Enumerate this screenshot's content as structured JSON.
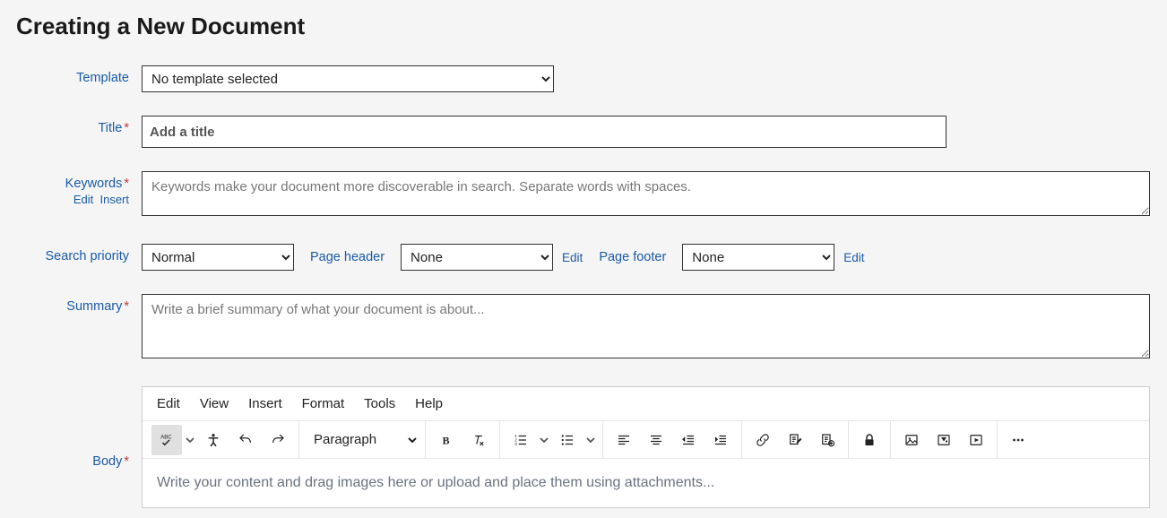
{
  "page_title": "Creating a New Document",
  "labels": {
    "template": "Template",
    "title": "Title",
    "keywords": "Keywords",
    "keywords_sub_edit": "Edit",
    "keywords_sub_insert": "Insert",
    "search_priority": "Search priority",
    "page_header": "Page header",
    "page_footer": "Page footer",
    "edit_link": "Edit",
    "summary": "Summary",
    "body": "Body"
  },
  "fields": {
    "template_selected": "No template selected",
    "title_value": "",
    "title_placeholder": "Add a title",
    "keywords_value": "",
    "keywords_placeholder": "Keywords make your document more discoverable in search. Separate words with spaces.",
    "search_priority_selected": "Normal",
    "page_header_selected": "None",
    "page_footer_selected": "None",
    "summary_value": "",
    "summary_placeholder": "Write a brief summary of what your document is about...",
    "body_placeholder": "Write your content and drag images here or upload and place them using attachments..."
  },
  "editor": {
    "menu": [
      "Edit",
      "View",
      "Insert",
      "Format",
      "Tools",
      "Help"
    ],
    "paragraph_label": "Paragraph"
  }
}
